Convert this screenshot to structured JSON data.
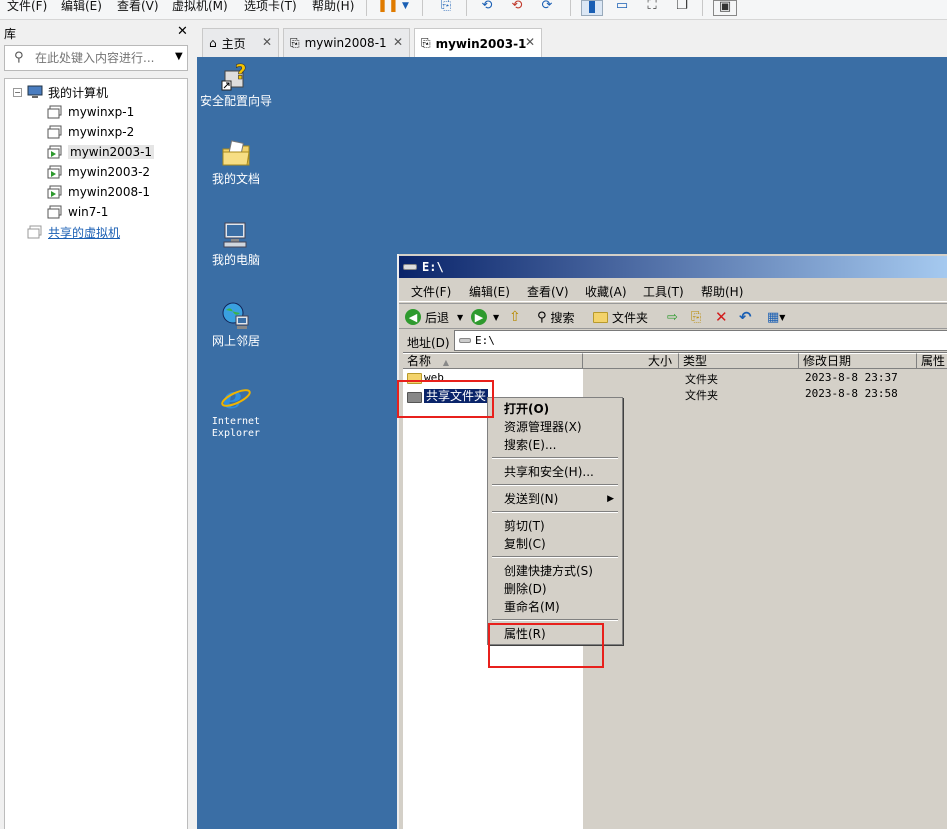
{
  "menubar": {
    "items": [
      "文件(F)",
      "编辑(E)",
      "查看(V)",
      "虚拟机(M)",
      "选项卡(T)",
      "帮助(H)"
    ]
  },
  "library": {
    "title": "库",
    "search_placeholder": "在此处键入内容进行...",
    "tree": {
      "root": "我的计算机",
      "vms": [
        "mywinxp-1",
        "mywinxp-2",
        "mywin2003-1",
        "mywin2003-2",
        "mywin2008-1",
        "win7-1"
      ],
      "selected": "mywin2003-1",
      "shared": "共享的虚拟机"
    }
  },
  "tabs": [
    {
      "label": "主页",
      "icon": "home-icon",
      "active": false
    },
    {
      "label": "mywin2008-1",
      "icon": "vm-icon",
      "active": false
    },
    {
      "label": "mywin2003-1",
      "icon": "vm-icon",
      "active": true
    }
  ],
  "desktop": {
    "icons": [
      {
        "label": "安全配置向导",
        "icon": "security-wizard-icon"
      },
      {
        "label": "我的文档",
        "icon": "my-documents-icon"
      },
      {
        "label": "我的电脑",
        "icon": "my-computer-icon"
      },
      {
        "label": "网上邻居",
        "icon": "network-places-icon"
      },
      {
        "label_line1": "Internet",
        "label_line2": "Explorer",
        "icon": "internet-explorer-icon"
      }
    ]
  },
  "explorer": {
    "title": "E:\\",
    "menu": [
      "文件(F)",
      "编辑(E)",
      "查看(V)",
      "收藏(A)",
      "工具(T)",
      "帮助(H)"
    ],
    "toolbar": {
      "back": "后退",
      "search": "搜索",
      "folders": "文件夹"
    },
    "address_label": "地址(D)",
    "address_value": "E:\\",
    "columns": [
      "名称",
      "大小",
      "类型",
      "修改日期",
      "属性"
    ],
    "files": [
      {
        "name": "web",
        "type": "文件夹",
        "modified": "2023-8-8 23:37"
      },
      {
        "name": "共享文件夹",
        "type": "文件夹",
        "modified": "2023-8-8 23:58"
      }
    ]
  },
  "context_menu": {
    "open": "打开(O)",
    "explorer": "资源管理器(X)",
    "search": "搜索(E)...",
    "sharing": "共享和安全(H)...",
    "send_to": "发送到(N)",
    "cut": "剪切(T)",
    "copy": "复制(C)",
    "shortcut": "创建快捷方式(S)",
    "delete": "删除(D)",
    "rename": "重命名(M)",
    "properties": "属性(R)"
  },
  "colors": {
    "desktop": "#3a6ea5",
    "title_bar": "#0a246a",
    "annotation": "#e8201c",
    "selection": "#0a246a"
  }
}
